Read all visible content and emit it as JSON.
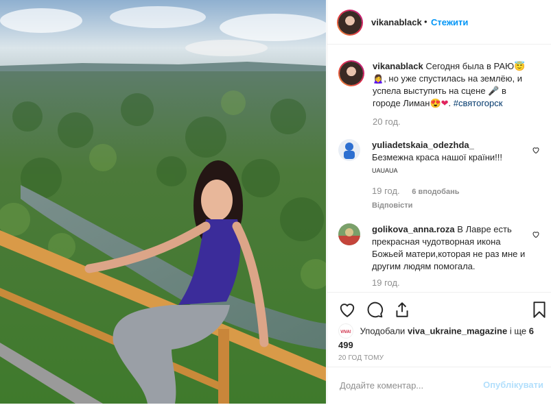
{
  "post": {
    "username": "vikanablack",
    "follow_label": "Стежити"
  },
  "caption": {
    "username": "vikanablack",
    "text_1": "Сегодня была в РАЮ",
    "text_2": ", но уже спустилась на землёю, и успела выступить на сцене",
    "text_3": " в городе Лиман",
    "hashtag": "#святогорск",
    "time": "20 год."
  },
  "comments": [
    {
      "username": "yuliadetskaia_odezhda_",
      "text": "Безмежна краса нашої країни!!!",
      "extra": "UAUAUA",
      "time": "19 год.",
      "likes": "6 вподобань",
      "reply": "Відповісти"
    },
    {
      "username": "golikova_anna.roza",
      "text": "В Лавре есть прекрасная чудотворная икона Божьей матери,которая не раз мне и другим людям помогала.",
      "time": "19 год."
    }
  ],
  "likes": {
    "prefix": "Уподобали",
    "user": "viva_ukraine_magazine",
    "middle": "і ще",
    "count": "6 499"
  },
  "timestamp": "20 ГОД ТОМУ",
  "add_comment": {
    "placeholder": "Додайте коментар...",
    "publish_label": "Опублікувати"
  },
  "colors": {
    "accent": "#0095f6",
    "like_red": "#ed4956",
    "shirt": "#3b2c9a"
  }
}
